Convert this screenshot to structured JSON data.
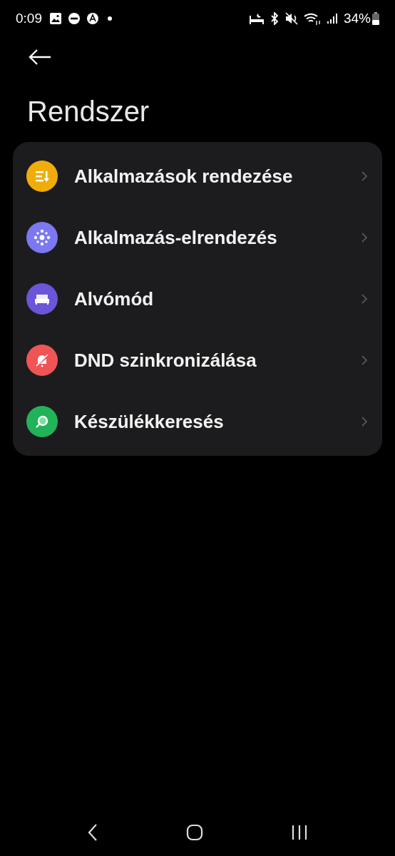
{
  "status_bar": {
    "time": "0:09",
    "battery": "34%"
  },
  "title": "Rendszer",
  "items": [
    {
      "label": "Alkalmazások rendezése",
      "kind": "sort",
      "color": "#f0ad0a"
    },
    {
      "label": "Alkalmazás-elrendezés",
      "kind": "grid",
      "color": "#7b78f2"
    },
    {
      "label": "Alvómód",
      "kind": "bed",
      "color": "#6a56d8"
    },
    {
      "label": "DND szinkronizálása",
      "kind": "bell",
      "color": "#f05556"
    },
    {
      "label": "Készülékkeresés",
      "kind": "search",
      "color": "#22b35a"
    }
  ]
}
